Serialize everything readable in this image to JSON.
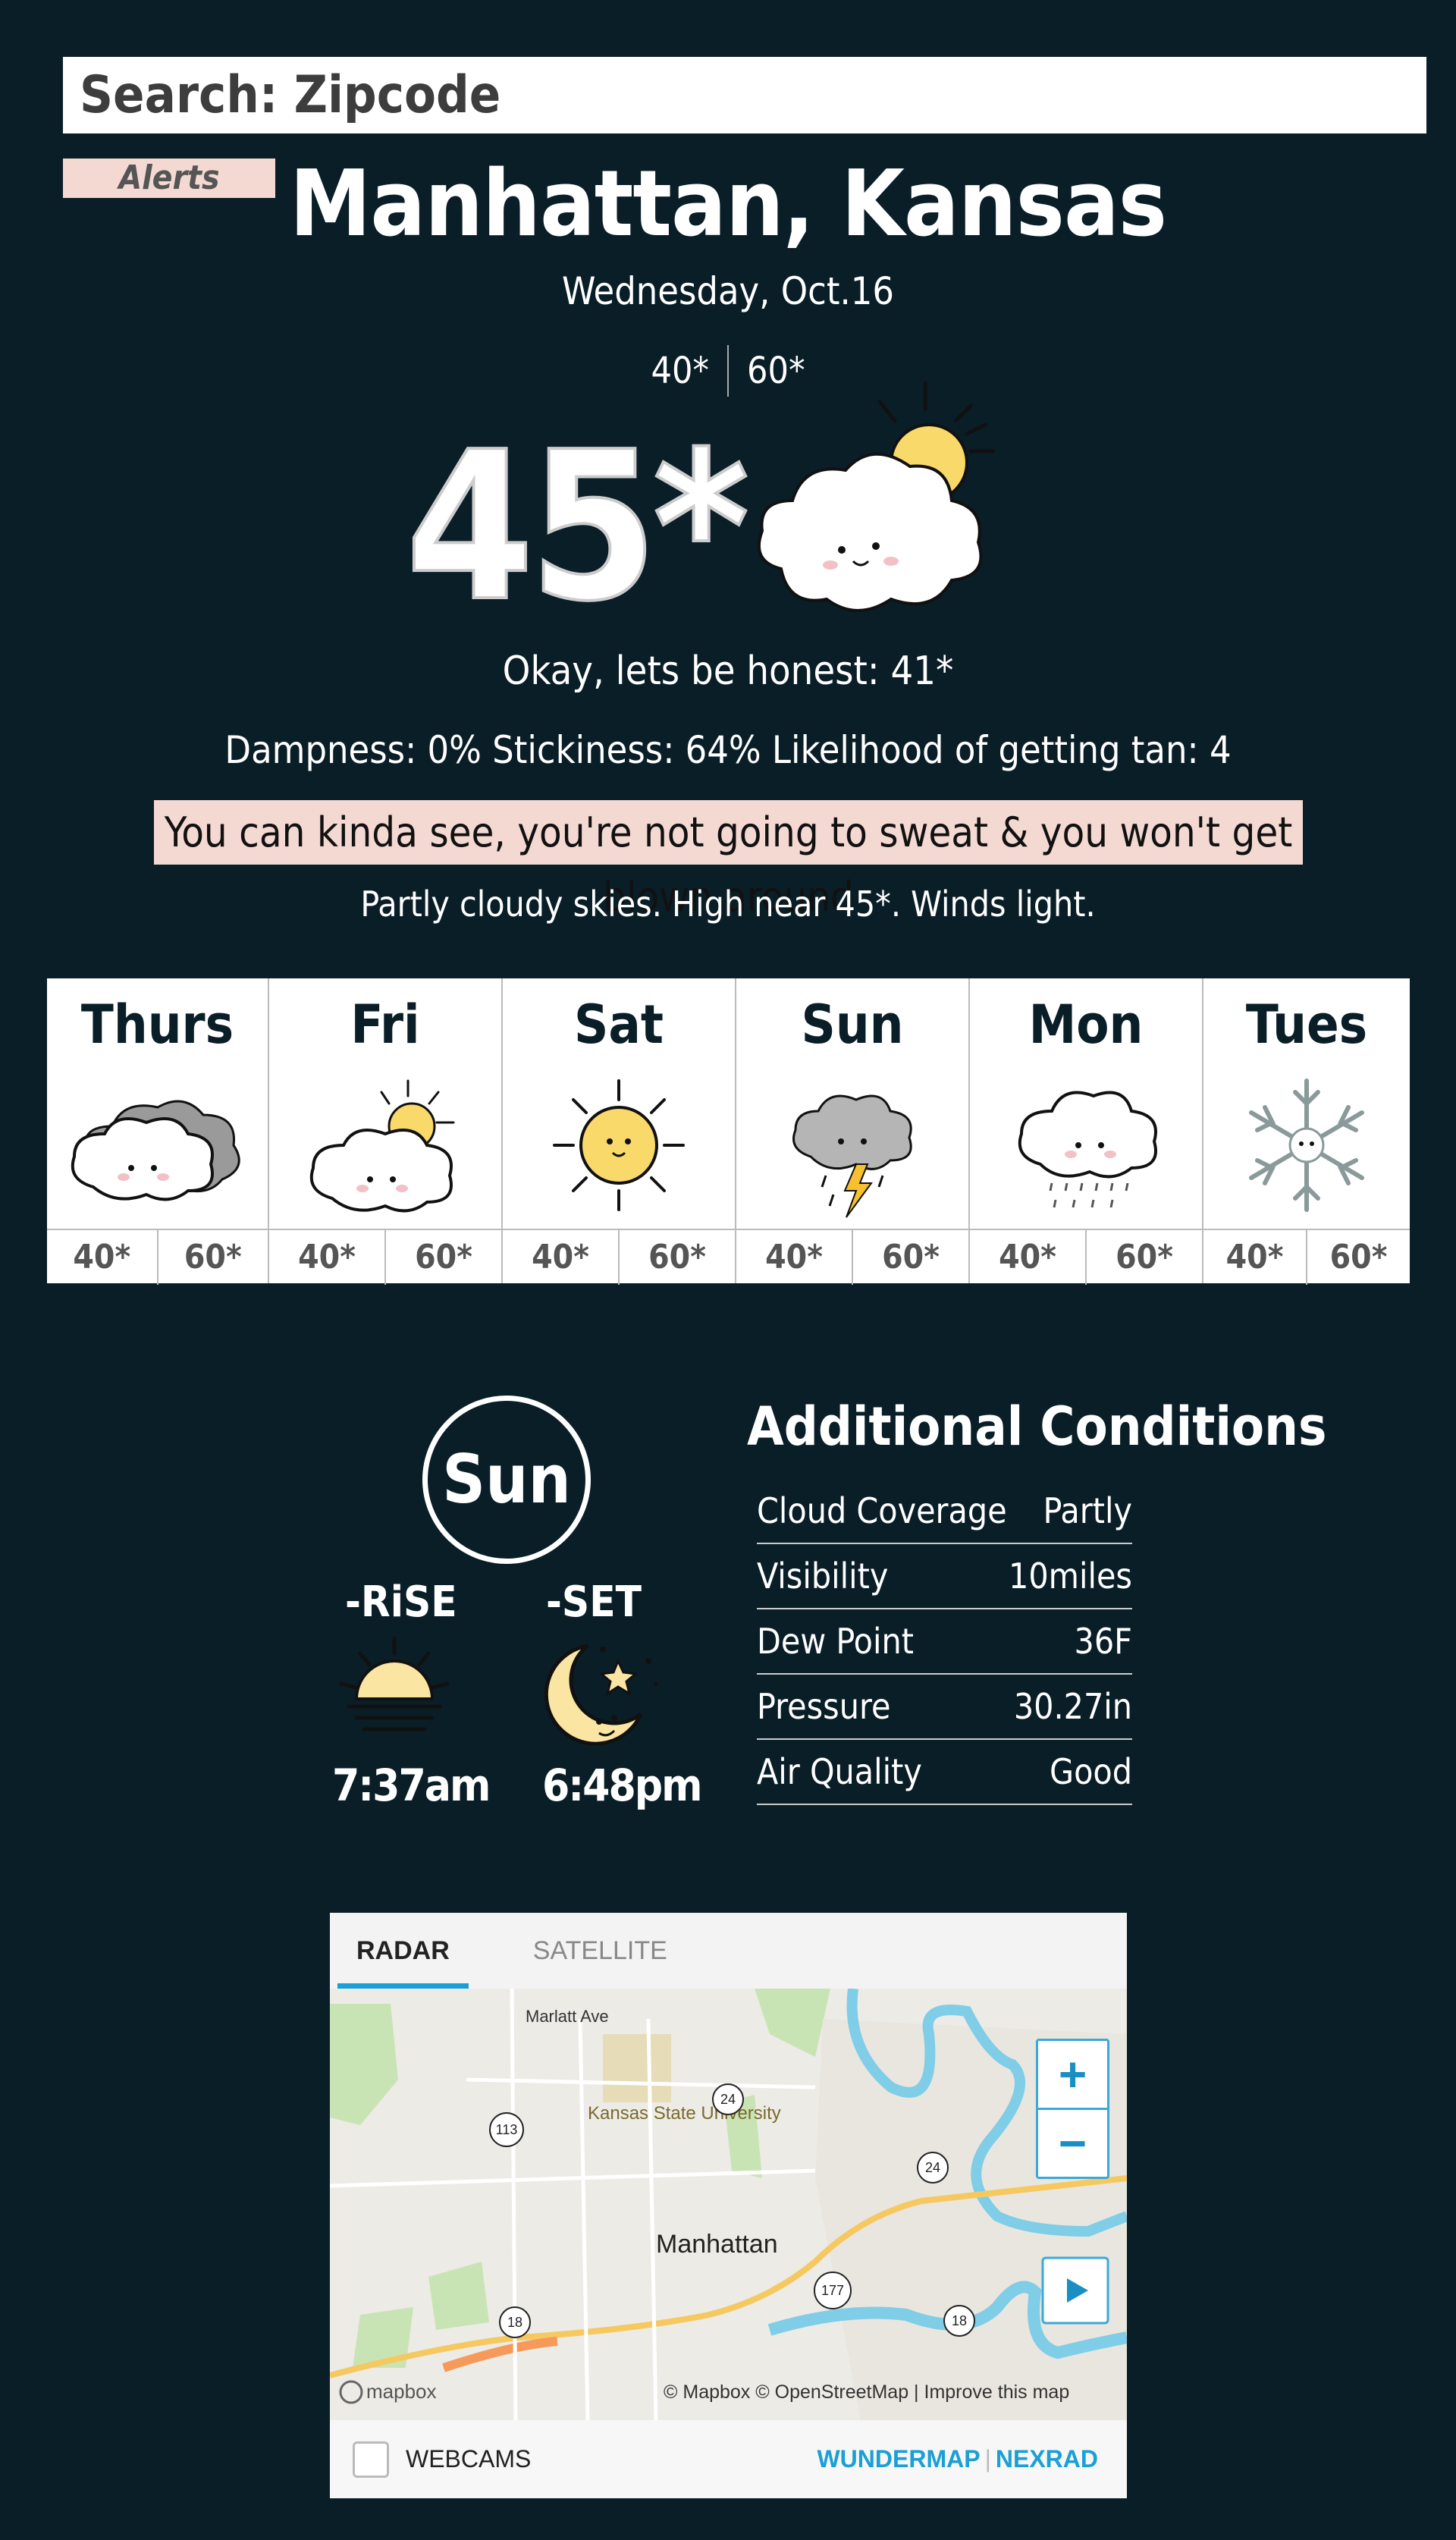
{
  "search": {
    "placeholder": "Search: Zipcode"
  },
  "alerts": {
    "label": "Alerts"
  },
  "location": {
    "city": "Manhattan, Kansas",
    "date": "Wednesday, Oct.16"
  },
  "today": {
    "low": "40*",
    "high": "60*",
    "current": "45*",
    "honest": "Okay, lets be honest: 41*",
    "stats": "Dampness: 0%  Stickiness: 64%  Likelihood of getting tan: 4",
    "verdict": "You can kinda see, you're not going to sweat & you won't get blown around",
    "description": "Partly cloudy skies. High near 45*. Winds light.",
    "icon": "partly-cloudy-icon"
  },
  "forecast": [
    {
      "day": "Thurs",
      "low": "40*",
      "high": "60*",
      "icon": "cloudy-icon"
    },
    {
      "day": "Fri",
      "low": "40*",
      "high": "60*",
      "icon": "partly-cloudy-icon"
    },
    {
      "day": "Sat",
      "low": "40*",
      "high": "60*",
      "icon": "sunny-icon"
    },
    {
      "day": "Sun",
      "low": "40*",
      "high": "60*",
      "icon": "thunderstorm-icon"
    },
    {
      "day": "Mon",
      "low": "40*",
      "high": "60*",
      "icon": "rain-icon"
    },
    {
      "day": "Tues",
      "low": "40*",
      "high": "60*",
      "icon": "snow-icon"
    }
  ],
  "sun": {
    "label": "Sun",
    "rise_label": "-RiSE",
    "set_label": "-SET",
    "rise": "7:37am",
    "set": "6:48pm"
  },
  "additional": {
    "title": "Additional Conditions",
    "rows": [
      {
        "label": "Cloud Coverage",
        "value": "Partly"
      },
      {
        "label": "Visibility",
        "value": "10miles"
      },
      {
        "label": "Dew Point",
        "value": "36F"
      },
      {
        "label": "Pressure",
        "value": "30.27in"
      },
      {
        "label": "Air Quality",
        "value": "Good"
      }
    ]
  },
  "map": {
    "tab_radar": "RADAR",
    "tab_satellite": "SATELLITE",
    "city": "Manhattan",
    "street": "Marlatt Ave",
    "university": "Kansas State University",
    "routes": [
      "113",
      "24",
      "24",
      "177",
      "18",
      "18"
    ],
    "attribution": "© Mapbox © OpenStreetMap | Improve this map",
    "mapbox_logo": "mapbox",
    "webcams": "WEBCAMS",
    "wundermap": "WUNDERMAP",
    "nexrad": "NEXRAD",
    "zoom_in": "+",
    "zoom_out": "−"
  }
}
